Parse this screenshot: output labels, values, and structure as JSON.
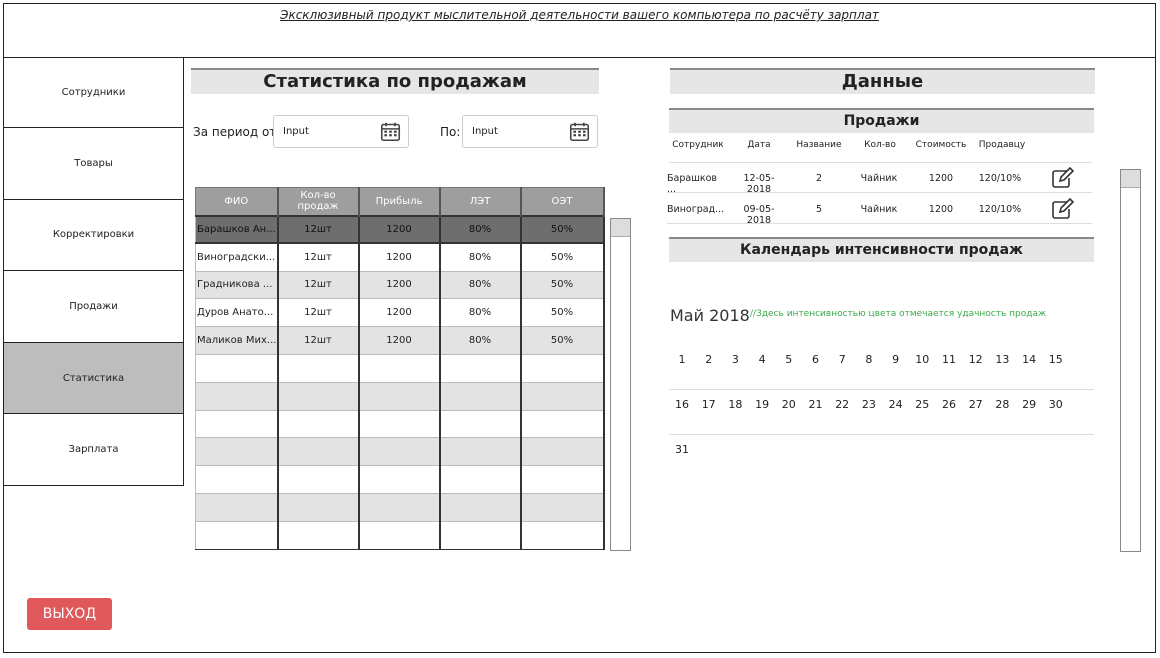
{
  "header": {
    "title": "Эксклюзивный продукт мыслительной деятельности вашего компьютера по расчёту зарплат"
  },
  "sidebar": {
    "items": [
      {
        "label": "Сотрудники"
      },
      {
        "label": "Товары"
      },
      {
        "label": "Корректировки"
      },
      {
        "label": "Продажи"
      },
      {
        "label": "Статистика",
        "active": true
      },
      {
        "label": "Зарплата"
      }
    ]
  },
  "stats": {
    "title": "Статистика по продажам",
    "period_from_label": "За период от:",
    "period_to_label": "По:",
    "from_input": "Input",
    "to_input": "Input",
    "columns": [
      "ФИО",
      "Кол-во продаж",
      "Прибыль",
      "ЛЭТ",
      "ОЭТ"
    ],
    "rows": [
      [
        "Барашков Ан...",
        "12шт",
        "1200",
        "80%",
        "50%"
      ],
      [
        "Виноградски...",
        "12шт",
        "1200",
        "80%",
        "50%"
      ],
      [
        "Градникова ...",
        "12шт",
        "1200",
        "80%",
        "50%"
      ],
      [
        "Дуров Анато...",
        "12шт",
        "1200",
        "80%",
        "50%"
      ],
      [
        "Маликов Мих...",
        "12шт",
        "1200",
        "80%",
        "50%"
      ]
    ]
  },
  "data_panel": {
    "title": "Данные",
    "sales_title": "Продажи",
    "sales_columns": [
      "Сотрудник",
      "Дата",
      "Название",
      "Кол-во",
      "Стоимость",
      "Продавцу"
    ],
    "sales_rows": [
      [
        "Барашков ...",
        "12-05-2018",
        "2",
        "Чайник",
        "1200",
        "120/10%"
      ],
      [
        "Виноград...",
        "09-05-2018",
        "5",
        "Чайник",
        "1200",
        "120/10%"
      ]
    ],
    "calendar_title": "Календарь интенсивности продаж",
    "month": "Май 2018",
    "hint": "//Здесь интенсивностью цвета отмечается удачность продаж",
    "week1": [
      "1",
      "2",
      "3",
      "4",
      "5",
      "6",
      "7",
      "8",
      "9",
      "10",
      "11",
      "12",
      "13",
      "14",
      "15"
    ],
    "week2": [
      "16",
      "17",
      "18",
      "19",
      "20",
      "21",
      "22",
      "23",
      "24",
      "25",
      "26",
      "27",
      "28",
      "29",
      "30"
    ],
    "week3": [
      "31"
    ]
  },
  "exit_button": "ВЫХОД",
  "icons": {
    "calendar": "calendar-icon",
    "edit": "edit-icon"
  },
  "colors": {
    "exit": "#e0585a",
    "hint": "#3daa4a",
    "active_nav": "#bdbdbd"
  }
}
